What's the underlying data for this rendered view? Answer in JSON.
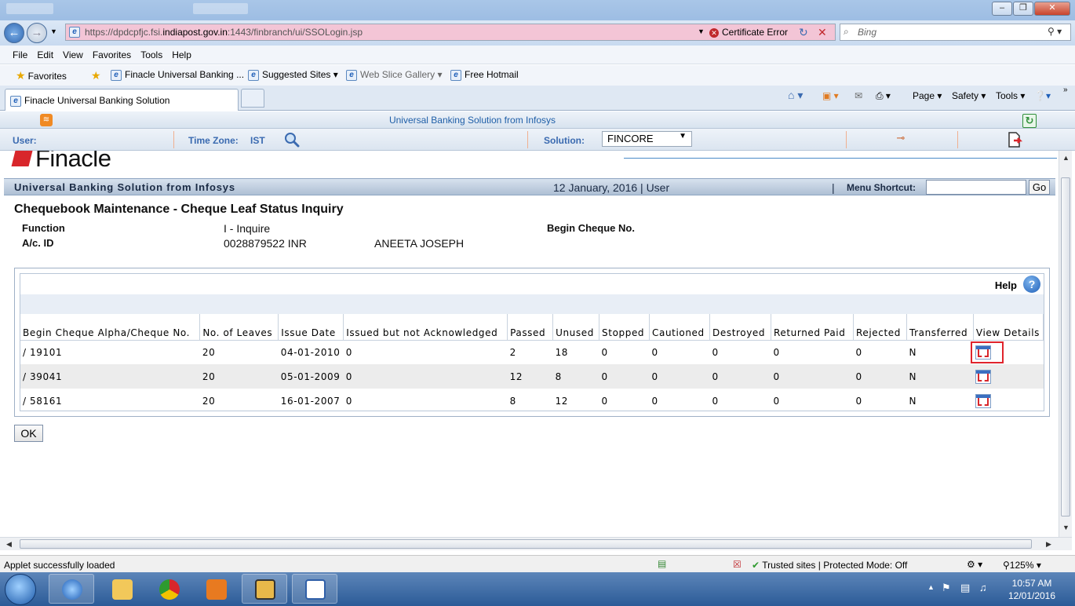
{
  "browser": {
    "url_prefix": "https://dpdcpfjc.fsi.",
    "url_host": "indiapost.gov.in",
    "url_suffix": ":1443/finbranch/ui/SSOLogin.jsp",
    "certificate_error": "Certificate Error",
    "search_placeholder": "Bing",
    "menu": [
      "File",
      "Edit",
      "View",
      "Favorites",
      "Tools",
      "Help"
    ],
    "favorites_label": "Favorites",
    "favorites_links": [
      "Finacle Universal Banking ...",
      "Suggested Sites ▾",
      "Web Slice Gallery ▾",
      "Free Hotmail"
    ],
    "tab_title": "Finacle Universal Banking Solution",
    "commands": [
      "Page ▾",
      "Safety ▾",
      "Tools ▾"
    ]
  },
  "finacle": {
    "banner_title": "Universal Banking Solution from Infosys",
    "user_label": "User:",
    "timezone_label": "Time Zone:",
    "timezone_value": "IST",
    "solution_label": "Solution:",
    "solution_value": "FINCORE",
    "logo_text": "Finacle",
    "ubs_title": "Universal Banking Solution from Infosys",
    "ubs_date": "12 January, 2016  |  User",
    "menu_shortcut_label": "Menu Shortcut:",
    "go_label": "Go"
  },
  "form": {
    "page_title": "Chequebook Maintenance - Cheque Leaf Status Inquiry",
    "function_label": "Function",
    "function_value": "I - Inquire",
    "account_label": "A/c. ID",
    "account_value": "0028879522  INR",
    "account_name": "ANEETA JOSEPH",
    "begin_cheque_label": "Begin Cheque No.",
    "help_label": "Help",
    "ok_label": "OK"
  },
  "table": {
    "headers": [
      "Begin Cheque Alpha/Cheque No.",
      "No. of Leaves",
      "Issue Date",
      "Issued but not Acknowledged",
      "Passed",
      "Unused",
      "Stopped",
      "Cautioned",
      "Destroyed",
      "Returned Paid",
      "Rejected",
      "Transferred",
      "View Details"
    ],
    "rows": [
      [
        "/ 19101",
        "20",
        "04-01-2010",
        "0",
        "2",
        "18",
        "0",
        "0",
        "0",
        "0",
        "0",
        "N"
      ],
      [
        "/ 39041",
        "20",
        "05-01-2009",
        "0",
        "12",
        "8",
        "0",
        "0",
        "0",
        "0",
        "0",
        "N"
      ],
      [
        "/ 58161",
        "20",
        "16-01-2007",
        "0",
        "8",
        "12",
        "0",
        "0",
        "0",
        "0",
        "0",
        "N"
      ]
    ]
  },
  "status": {
    "left": "Applet successfully loaded",
    "zone": "Trusted sites | Protected Mode: Off",
    "zoom": "125%"
  },
  "clock": {
    "time": "10:57 AM",
    "date": "12/01/2016"
  }
}
